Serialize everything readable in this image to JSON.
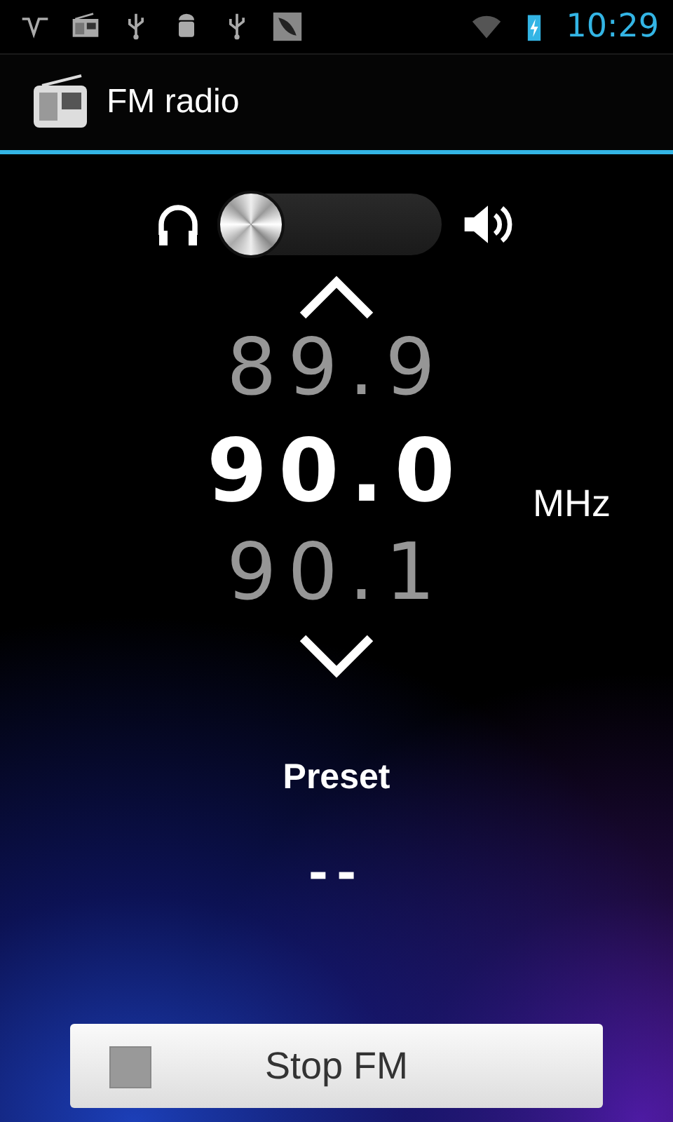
{
  "status_bar": {
    "time": "10:29"
  },
  "action_bar": {
    "title": "FM radio"
  },
  "audio_output": {
    "speaker_on": false
  },
  "tuner": {
    "frequencies": [
      {
        "value": "89.9",
        "selected": false
      },
      {
        "value": "90.0",
        "selected": true
      },
      {
        "value": "90.1",
        "selected": false
      }
    ],
    "unit": "MHz"
  },
  "preset": {
    "label": "Preset",
    "value": "--"
  },
  "button": {
    "label": "Stop FM"
  }
}
